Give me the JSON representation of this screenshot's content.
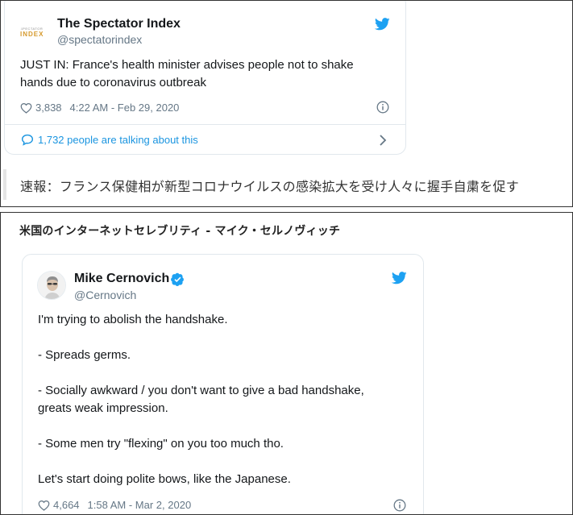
{
  "tweet1": {
    "author_name": "The Spectator Index",
    "author_handle": "@spectatorindex",
    "avatar_line1": "SPECTATOR",
    "avatar_line2": "INDEX",
    "text": "JUST IN: France's health minister advises people not to shake\nhands due to coronavirus outbreak",
    "likes": "3,838",
    "timestamp": "4:22 AM - Feb 29, 2020",
    "talking": "1,732 people are talking about this"
  },
  "caption": "速報：フランス保健相が新型コロナウイルスの感染拡大を受け人々に握手自粛を促す",
  "heading": "米国のインターネットセレブリティ - マイク・セルノヴィッチ",
  "tweet2": {
    "author_name": "Mike Cernovich",
    "author_handle": "@Cernovich",
    "text": "I'm trying to abolish the handshake.\n\n- Spreads germs.\n\n- Socially awkward / you don't want to give a bad handshake,\ngreats weak impression.\n\n- Some men try \"flexing\" on you too much tho.\n\nLet's start doing polite bows, like the Japanese.",
    "likes": "4,664",
    "timestamp": "1:58 AM - Mar 2, 2020"
  },
  "icons": {
    "bird": "twitter-bird-icon",
    "heart": "heart-icon",
    "info": "info-icon",
    "verified": "verified-badge-icon",
    "bubble": "speech-bubble-icon",
    "chevron": "chevron-right-icon"
  },
  "colors": {
    "twitter_blue": "#1da1f2",
    "link_blue": "#1b95e0",
    "muted": "#657786",
    "border": "#e1e8ed"
  }
}
